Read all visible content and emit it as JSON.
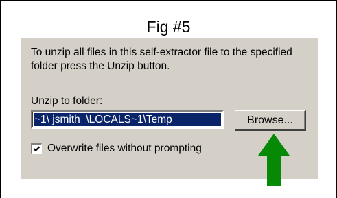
{
  "figure": {
    "title": "Fig #5"
  },
  "dialog": {
    "instructions": "To unzip all files in this self-extractor file to the specified folder press the Unzip button.",
    "unzip_label": "Unzip to folder:",
    "folder_value": "~1\\ jsmith  \\LOCALS~1\\Temp",
    "browse_label": "Browse...",
    "overwrite_checked": true,
    "overwrite_label": "Overwrite files without prompting",
    "background_color": "#d4d0c8",
    "selection_color": "#0a246a"
  },
  "annotation": {
    "arrow_icon": "up-arrow-icon",
    "arrow_color": "#068a06"
  }
}
